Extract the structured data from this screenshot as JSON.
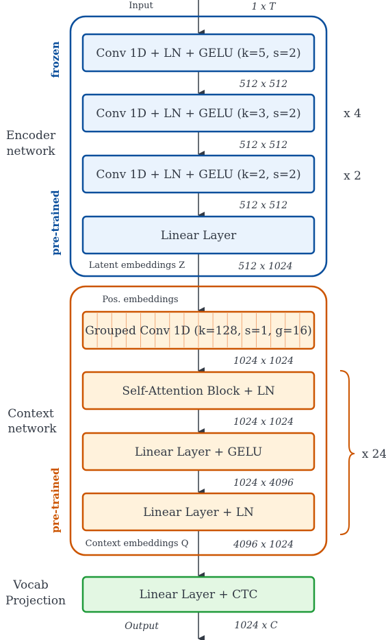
{
  "input": {
    "label": "Input",
    "dim": "1 x T"
  },
  "encoder": {
    "name_line1": "Encoder",
    "name_line2": "network",
    "frozen_label": "frozen",
    "pretrained_label": "pre-trained",
    "blocks": [
      {
        "label": "Conv 1D + LN + GELU (k=5, s=2)",
        "dim": "512 x 512",
        "repeat": ""
      },
      {
        "label": "Conv 1D + LN + GELU (k=3, s=2)",
        "dim": "512 x 512",
        "repeat": "x 4"
      },
      {
        "label": "Conv 1D + LN + GELU (k=2, s=2)",
        "dim": "512 x 512",
        "repeat": "x 2"
      },
      {
        "label": "Linear Layer",
        "dim": "512 x 1024",
        "repeat": ""
      }
    ],
    "output_label": "Latent embeddings Z",
    "color": "#0b4f9c",
    "fill": "#eaf3fd"
  },
  "context": {
    "name_line1": "Context",
    "name_line2": "network",
    "pretrained_label": "pre-trained",
    "pos_label": "Pos. embeddings",
    "blocks": [
      {
        "label": "Grouped Conv 1D (k=128, s=1, g=16)",
        "dim": "1024 x 1024"
      },
      {
        "label": "Self-Attention Block + LN",
        "dim": "1024 x 1024"
      },
      {
        "label": "Linear Layer + GELU",
        "dim": "1024 x 4096"
      },
      {
        "label": "Linear Layer + LN",
        "dim": "4096 x 1024"
      }
    ],
    "repeat": "x 24",
    "output_label": "Context embeddings Q",
    "color": "#cc5500",
    "fill": "#fff2dc"
  },
  "vocab": {
    "name_line1": "Vocab",
    "name_line2": "Projection",
    "block": "Linear Layer + CTC",
    "output_label": "Output",
    "dim": "1024 x C",
    "color": "#1f9a3a",
    "fill": "#e3f7e3"
  }
}
